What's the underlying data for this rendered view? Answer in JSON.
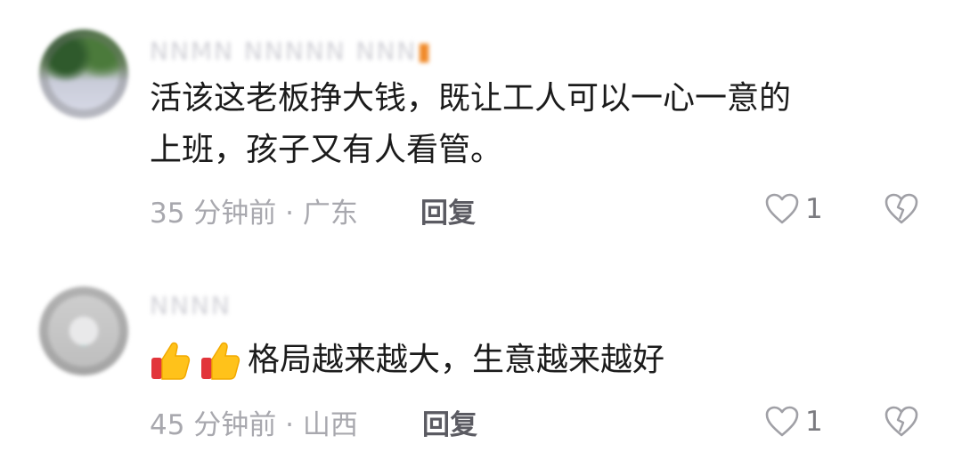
{
  "comments": [
    {
      "username": "ΝΝΜΝ ΝΝΝΝΝ ΝΝΝ",
      "content": "活该这老板挣大钱，既让工人可以一心一意的\n上班，孩子又有人看管。",
      "time_location": "35 分钟前 · 广东",
      "reply_label": "回复",
      "like_count": "1"
    },
    {
      "username": "ΝΝΝΝ",
      "emoji": [
        "thumbs-up",
        "thumbs-up"
      ],
      "content": "格局越来越大，生意越来越好",
      "time_location": "45 分钟前 · 山西",
      "reply_label": "回复",
      "like_count": "1"
    }
  ],
  "colors": {
    "meta": "#a8a8ae",
    "text": "#1b1b1b",
    "reply": "#5b5b62",
    "icon": "#a0a0a6"
  }
}
